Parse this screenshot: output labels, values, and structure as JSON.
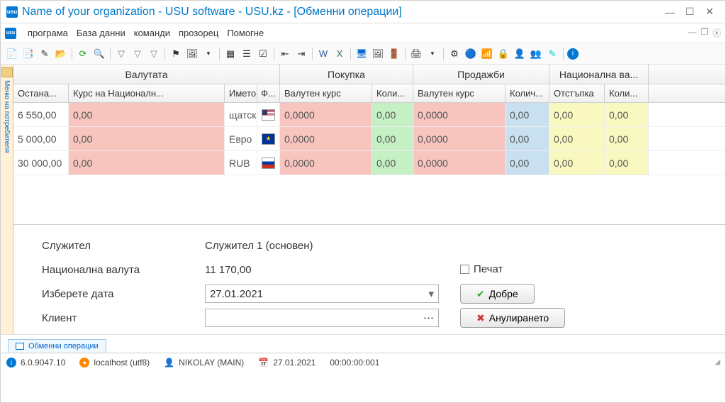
{
  "window": {
    "title": "Name of your organization - USU software - USU.kz - [Обменни операции]"
  },
  "menu": {
    "program": "програма",
    "database": "База данни",
    "commands": "команди",
    "window": "прозорец",
    "help": "Помогне"
  },
  "sidebar": {
    "label": "Меню на потребителя"
  },
  "grid": {
    "groups": {
      "currency": "Валутата",
      "buy": "Покупка",
      "sell": "Продажби",
      "national": "Национална ва..."
    },
    "cols": {
      "remain": "Остана...",
      "nbrate": "Курс на Националн...",
      "name": "Името",
      "flag": "Ф...",
      "vrate": "Валутен курс",
      "qty": "Коли...",
      "vrate2": "Валутен курс",
      "qty2": "Колич...",
      "discount": "Отстъпка",
      "qty3": "Коли..."
    },
    "rows": [
      {
        "remain": "6 550,00",
        "nbrate": "0,00",
        "name": "щатски",
        "flag": "us",
        "vrate": "0,0000",
        "qty": "0,00",
        "vrate2": "0,0000",
        "qty2": "0,00",
        "discount": "0,00",
        "qty3": "0,00"
      },
      {
        "remain": "5 000,00",
        "nbrate": "0,00",
        "name": "Евро",
        "flag": "eu",
        "vrate": "0,0000",
        "qty": "0,00",
        "vrate2": "0,0000",
        "qty2": "0,00",
        "discount": "0,00",
        "qty3": "0,00"
      },
      {
        "remain": "30 000,00",
        "nbrate": "0,00",
        "name": "RUB",
        "flag": "ru",
        "vrate": "0,0000",
        "qty": "0,00",
        "vrate2": "0,0000",
        "qty2": "0,00",
        "discount": "0,00",
        "qty3": "0,00"
      }
    ]
  },
  "form": {
    "employee_l": "Служител",
    "employee_v": "Служител 1 (основен)",
    "national_l": "Национална валута",
    "national_v": "11 170,00",
    "date_l": "Изберете дата",
    "date_v": "27.01.2021",
    "client_l": "Клиент",
    "print_l": "Печат",
    "ok_l": "Добре",
    "cancel_l": "Анулирането"
  },
  "tab": {
    "label": "Обменни операции"
  },
  "status": {
    "version": "6.0.9047.10",
    "host": "localhost (utf8)",
    "user": "NIKOLAY (MAIN)",
    "date": "27.01.2021",
    "time": "00:00:00:001"
  }
}
